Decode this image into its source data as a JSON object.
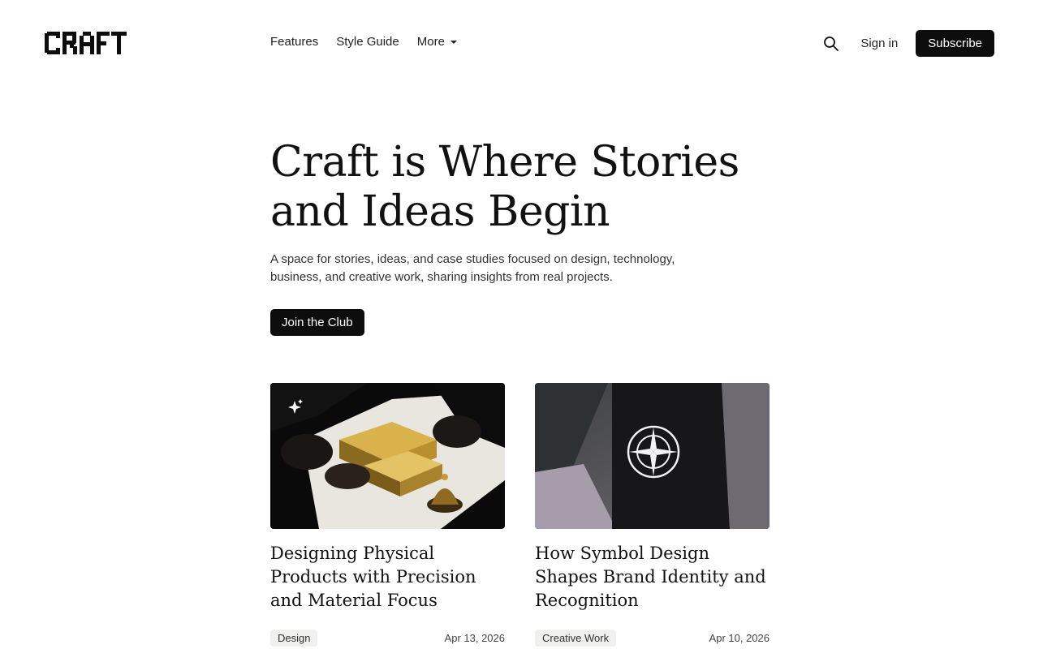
{
  "brand": {
    "logo_text": "CRAFT"
  },
  "nav": {
    "items": [
      {
        "label": "Features"
      },
      {
        "label": "Style Guide"
      },
      {
        "label": "More"
      }
    ]
  },
  "header": {
    "signin_label": "Sign in",
    "subscribe_label": "Subscribe",
    "icons": [
      "search-icon",
      "chevron-down-icon",
      "sparkle-icon",
      "compass-icon"
    ]
  },
  "hero": {
    "title_line1": "Craft is Where Stories",
    "title_line2": "and Ideas Begin",
    "description": "A space for stories, ideas, and case studies focused on design, technology, business, and creative work, sharing insights from real projects.",
    "cta_label": "Join the Club"
  },
  "posts": [
    {
      "title": "Designing Physical Products with Precision and Material Focus",
      "tag": "Design",
      "date": "Apr 13, 2026"
    },
    {
      "title": "How Symbol Design Shapes Brand Identity and Recognition",
      "tag": "Creative Work",
      "date": "Apr 10, 2026"
    }
  ],
  "colors": {
    "primary": "#0d0d0d",
    "tag_bg": "#f0f0ee",
    "text": "#111111"
  }
}
